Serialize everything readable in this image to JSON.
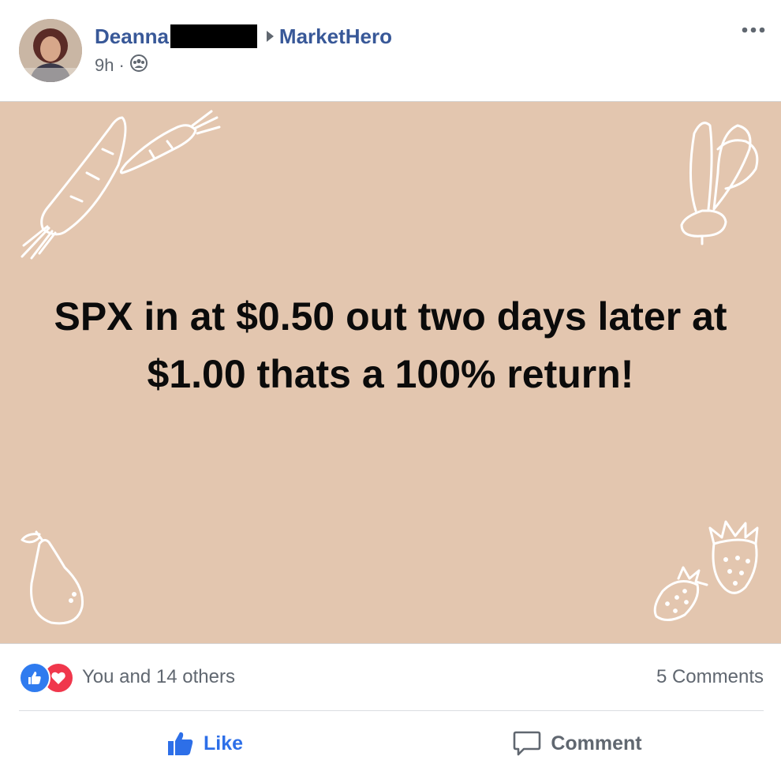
{
  "post": {
    "author_name": "Deanna",
    "group_name": "MarketHero",
    "time": "9h",
    "separator": "·",
    "privacy_icon": "group-icon",
    "more_icon": "more-options-icon",
    "body_text": "SPX in at $0.50 out two days later at $1.00 thats a 100% return!",
    "background_color": "#e3c6af"
  },
  "reactions": {
    "summary": "You and 14 others",
    "types": [
      "like",
      "love"
    ],
    "comments_count": "5 Comments"
  },
  "actions": {
    "like_label": "Like",
    "comment_label": "Comment"
  },
  "colors": {
    "link": "#385898",
    "like_accent": "#2d6fe8",
    "love": "#f0374c",
    "muted": "#606770"
  }
}
